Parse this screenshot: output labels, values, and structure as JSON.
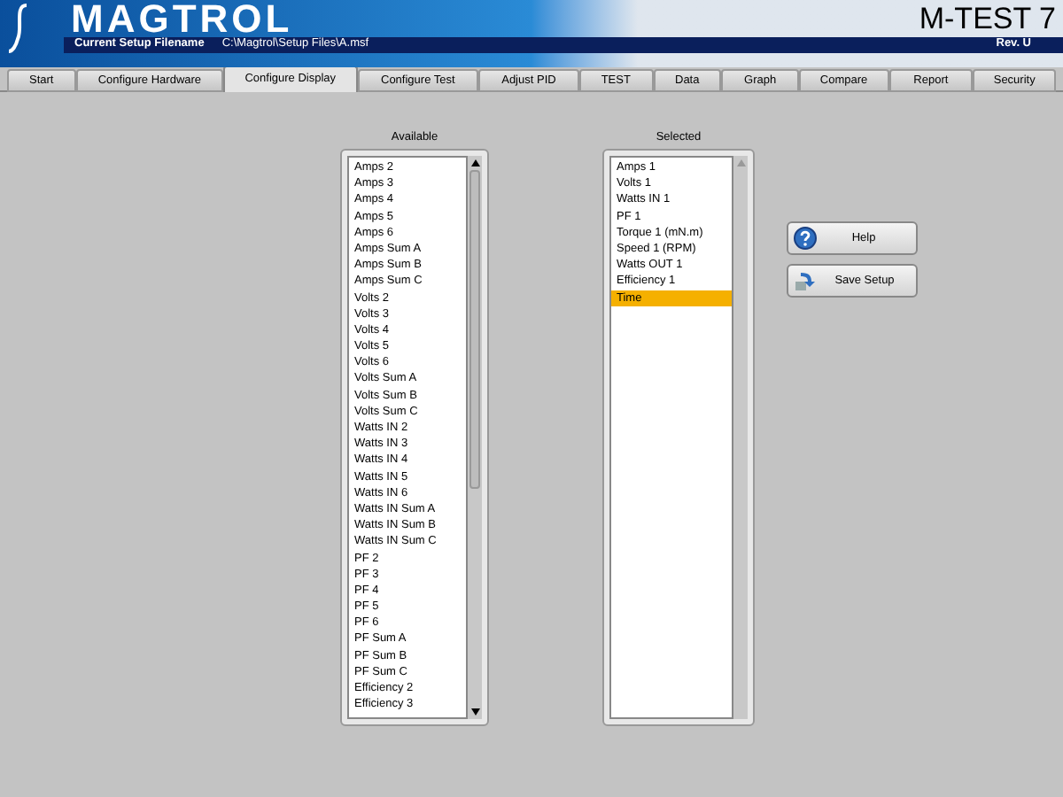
{
  "header": {
    "logo": "MAGTROL",
    "product": "M-TEST 7",
    "filename_label": "Current Setup Filename",
    "filename": "C:\\Magtrol\\Setup Files\\A.msf",
    "revision": "Rev. U"
  },
  "tabs": [
    {
      "label": "Start",
      "selected": false
    },
    {
      "label": "Configure Hardware",
      "selected": false
    },
    {
      "label": "Configure Display",
      "selected": true
    },
    {
      "label": "Configure Test",
      "selected": false
    },
    {
      "label": "Adjust PID",
      "selected": false
    },
    {
      "label": "TEST",
      "selected": false
    },
    {
      "label": "Data",
      "selected": false
    },
    {
      "label": "Graph",
      "selected": false
    },
    {
      "label": "Compare",
      "selected": false
    },
    {
      "label": "Report",
      "selected": false
    },
    {
      "label": "Security",
      "selected": false
    }
  ],
  "available": {
    "title": "Available",
    "items": [
      {
        "label": "Amps 2",
        "selected": false
      },
      {
        "label": "Amps 3",
        "selected": false
      },
      {
        "label": "Amps 4",
        "selected": false
      },
      {
        "label": "Amps 5",
        "selected": false
      },
      {
        "label": "Amps 6",
        "selected": false
      },
      {
        "label": "Amps Sum A",
        "selected": false
      },
      {
        "label": "Amps Sum B",
        "selected": false
      },
      {
        "label": "Amps Sum C",
        "selected": false
      },
      {
        "label": "Volts 2",
        "selected": false
      },
      {
        "label": "Volts 3",
        "selected": false
      },
      {
        "label": "Volts 4",
        "selected": false
      },
      {
        "label": "Volts 5",
        "selected": false
      },
      {
        "label": "Volts 6",
        "selected": false
      },
      {
        "label": "Volts Sum A",
        "selected": false
      },
      {
        "label": "Volts Sum B",
        "selected": false
      },
      {
        "label": "Volts Sum C",
        "selected": false
      },
      {
        "label": "Watts IN 2",
        "selected": false
      },
      {
        "label": "Watts IN 3",
        "selected": false
      },
      {
        "label": "Watts IN 4",
        "selected": false
      },
      {
        "label": "Watts IN 5",
        "selected": false
      },
      {
        "label": "Watts IN 6",
        "selected": false
      },
      {
        "label": "Watts IN Sum A",
        "selected": false
      },
      {
        "label": "Watts IN Sum B",
        "selected": false
      },
      {
        "label": "Watts IN Sum C",
        "selected": false
      },
      {
        "label": "PF 2",
        "selected": false
      },
      {
        "label": "PF 3",
        "selected": false
      },
      {
        "label": "PF 4",
        "selected": false
      },
      {
        "label": "PF 5",
        "selected": false
      },
      {
        "label": "PF 6",
        "selected": false
      },
      {
        "label": "PF Sum A",
        "selected": false
      },
      {
        "label": "PF Sum B",
        "selected": false
      },
      {
        "label": "PF Sum C",
        "selected": false
      },
      {
        "label": "Efficiency 2",
        "selected": false
      },
      {
        "label": "Efficiency 3",
        "selected": false
      }
    ]
  },
  "selected_list": {
    "title": "Selected",
    "items": [
      {
        "label": "Amps 1",
        "selected": false
      },
      {
        "label": "Volts 1",
        "selected": false
      },
      {
        "label": "Watts IN 1",
        "selected": false
      },
      {
        "label": "PF 1",
        "selected": false
      },
      {
        "label": "Torque 1 (mN.m)",
        "selected": false
      },
      {
        "label": "Speed 1 (RPM)",
        "selected": false
      },
      {
        "label": "Watts OUT 1",
        "selected": false
      },
      {
        "label": "Efficiency 1",
        "selected": false
      },
      {
        "label": "Time",
        "selected": true
      }
    ]
  },
  "buttons": [
    {
      "kind": "help",
      "label": "Help"
    },
    {
      "kind": "save",
      "label": "Save Setup"
    }
  ]
}
